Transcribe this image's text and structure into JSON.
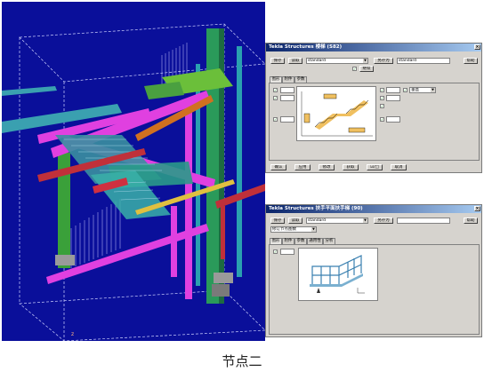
{
  "caption": "节点二",
  "viewport": {
    "background": "#0a0f9a",
    "axis_mark": "z"
  },
  "dialog1": {
    "title": "Tekla Structures  楼梯 (S82)",
    "buttons": {
      "save": "保存",
      "load": "读取",
      "save_as": "另存为",
      "help": "帮助",
      "apply_all": "继续"
    },
    "attr_value": "standard",
    "save_as_value": "standard",
    "tabs": [
      "图形",
      "附件",
      "参数"
    ],
    "combo_right": "垂直",
    "bottom_buttons": {
      "ok": "确认",
      "apply": "应用",
      "modify": "修改",
      "get": "获取",
      "toggle": "☑/□",
      "cancel": "取消"
    }
  },
  "dialog2": {
    "title": "Tekla Structures  扶手平面扶手梯 (90)",
    "buttons": {
      "save": "保存",
      "load": "读取",
      "save_as": "另存为",
      "help": "帮助"
    },
    "attr_value": "standard",
    "save_as_value": "",
    "combo_value": "修订节点图数",
    "tabs": [
      "图形",
      "附件",
      "参数",
      "通用性",
      "分析"
    ]
  },
  "colors": {
    "titlebar": "#0a246a",
    "dialog_bg": "#d6d3ce",
    "magenta": "#e040e0",
    "green": "#3aa03a",
    "cyan": "#2aa0b0",
    "red": "#b0102a"
  }
}
